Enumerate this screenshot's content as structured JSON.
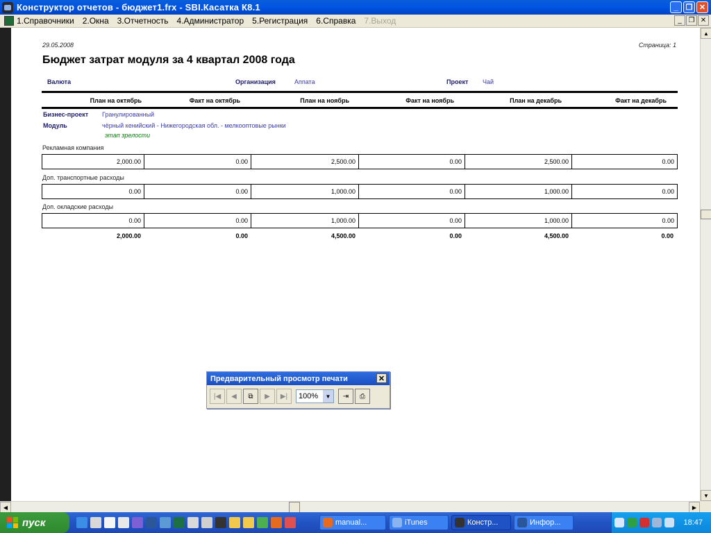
{
  "window": {
    "title": "Конструктор отчетов - бюджет1.frx - SBI.Касатка К8.1",
    "buttons": {
      "minimize": "_",
      "restore": "❐",
      "close": "✕"
    }
  },
  "menu": {
    "items": [
      {
        "label": "1.Справочники",
        "disabled": false
      },
      {
        "label": "2.Окна",
        "disabled": false
      },
      {
        "label": "3.Отчетность",
        "disabled": false
      },
      {
        "label": "4.Администратор",
        "disabled": false
      },
      {
        "label": "5.Регистрация",
        "disabled": false
      },
      {
        "label": "6.Справка",
        "disabled": false
      },
      {
        "label": "7.Выход",
        "disabled": true
      }
    ],
    "mdi": {
      "minimize": "_",
      "restore": "❐",
      "close": "✕"
    }
  },
  "report": {
    "date": "29.05.2008",
    "page": "Страница: 1",
    "title": "Бюджет затрат модуля за 4 квартал 2008 года",
    "currency_label": "Валюта",
    "org_label": "Организация",
    "org_value": "Аппата",
    "project_label": "Проект",
    "project_value": "Чай",
    "columns": [
      "План на октябрь",
      "Факт на октябрь",
      "План на ноябрь",
      "Факт на ноябрь",
      "План на декабрь",
      "Факт на декабрь"
    ],
    "biz_label": "Бизнес-проект",
    "biz_value": "Гранулированный",
    "module_label": "Модуль",
    "module_value": "чёрный кенийский - Нижегородская обл. - мелкооптовые рынки",
    "stage": "этап зрелости",
    "rows": [
      {
        "label": "Рекламная компания",
        "values": [
          "2,000.00",
          "0.00",
          "2,500.00",
          "0.00",
          "2,500.00",
          "0.00"
        ]
      },
      {
        "label": "Доп. транспортные расходы",
        "values": [
          "0.00",
          "0.00",
          "1,000.00",
          "0.00",
          "1,000.00",
          "0.00"
        ]
      },
      {
        "label": "Доп. окладские расходы",
        "values": [
          "0.00",
          "0.00",
          "1,000.00",
          "0.00",
          "1,000.00",
          "0.00"
        ]
      }
    ],
    "totals": [
      "2,000.00",
      "0.00",
      "4,500.00",
      "0.00",
      "4,500.00",
      "0.00"
    ]
  },
  "preview": {
    "title": "Предварительный просмотр печати",
    "close": "✕",
    "zoom": "100%",
    "buttons": {
      "first": "|◀",
      "prev": "◀",
      "pages": "⧉",
      "next": "▶",
      "last": "▶|",
      "exit": "⇥",
      "print": "⎙"
    }
  },
  "taskbar": {
    "start": "пуск",
    "tasks": [
      {
        "label": "manual...",
        "icon_color": "#e66b1f"
      },
      {
        "label": "iTunes",
        "icon_color": "#8ab4f0"
      },
      {
        "label": "Констр...",
        "icon_color": "#333333"
      },
      {
        "label": "Инфор...",
        "icon_color": "#2b579a"
      }
    ],
    "clock": "18:47"
  }
}
